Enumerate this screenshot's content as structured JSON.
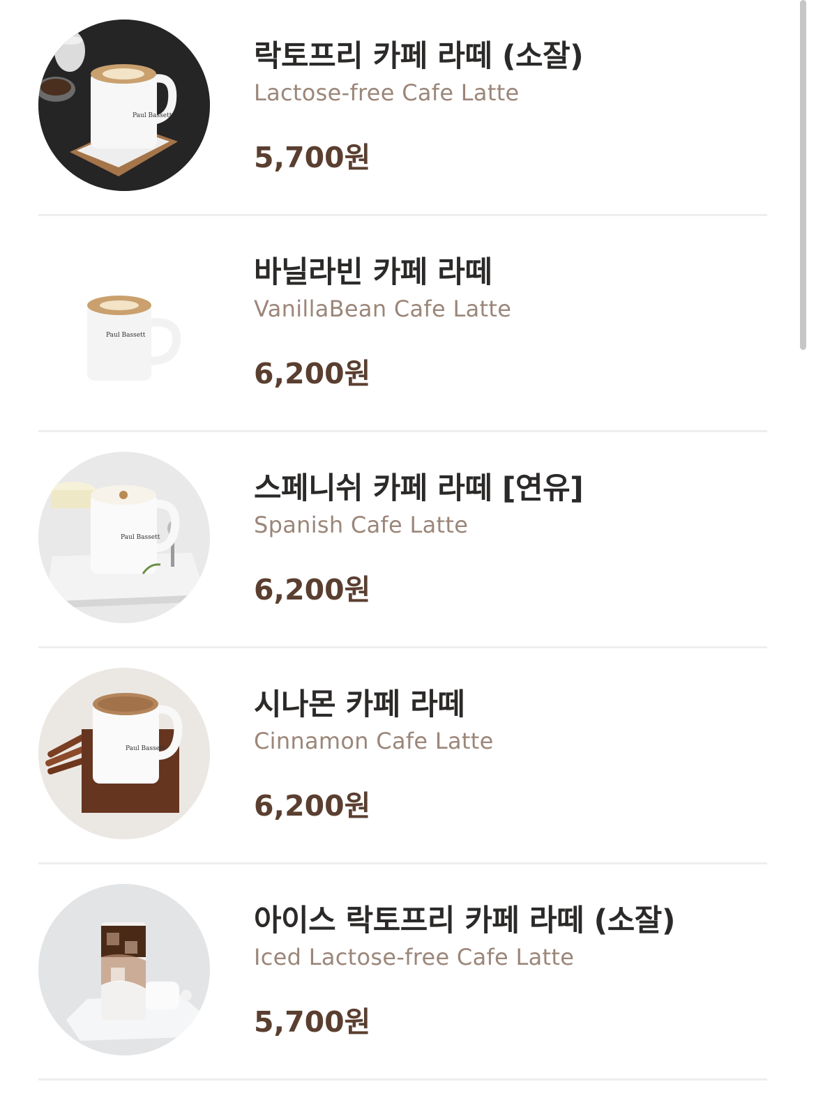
{
  "menu": {
    "items": [
      {
        "name": "락토프리 카페 라떼 (소잘)",
        "english_name": "Lactose-free Cafe Latte",
        "price": "5,700원",
        "image": "hot-latte-mug-dark-background"
      },
      {
        "name": "바닐라빈 카페 라떼",
        "english_name": "VanillaBean Cafe Latte",
        "price": "6,200원",
        "image": "hot-latte-mug-white-background"
      },
      {
        "name": "스페니쉬 카페 라떼 [연유]",
        "english_name": "Spanish Cafe Latte",
        "price": "6,200원",
        "image": "hot-latte-mug-marble-tray"
      },
      {
        "name": "시나몬 카페 라떼",
        "english_name": "Cinnamon Cafe Latte",
        "price": "6,200원",
        "image": "cinnamon-latte-mug-wood-board"
      },
      {
        "name": "아이스 락토프리 카페 라떼 (소잘)",
        "english_name": "Iced Lactose-free Cafe Latte",
        "price": "5,700원",
        "image": "iced-latte-glass"
      }
    ]
  },
  "colors": {
    "name_text": "#2c2a29",
    "english_text": "#9b8679",
    "price_text": "#5a3f30",
    "divider": "#eeeeee"
  }
}
